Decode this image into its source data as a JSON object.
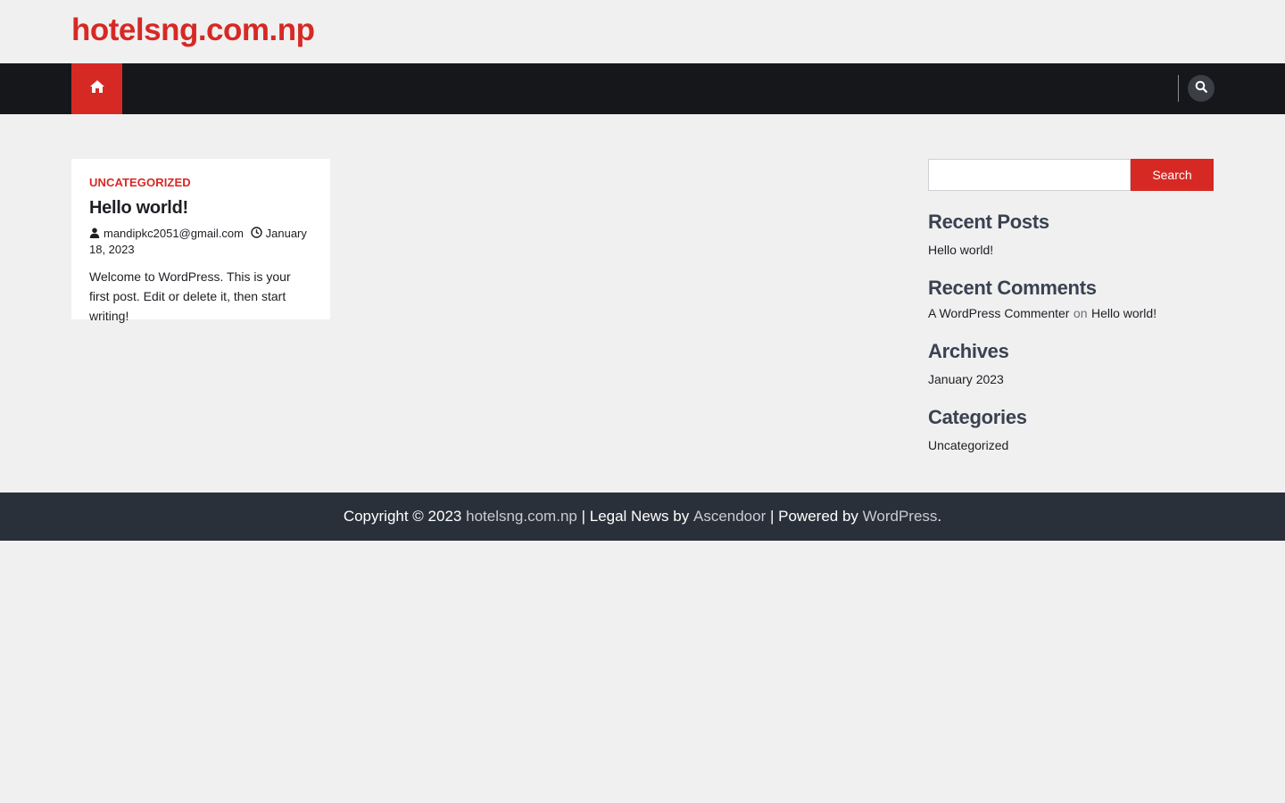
{
  "header": {
    "site_title": "hotelsng.com.np"
  },
  "nav": {
    "home_icon": "home-icon",
    "search_icon": "search-icon"
  },
  "post": {
    "category": "Uncategorized",
    "title": "Hello world!",
    "author": "mandipkc2051@gmail.com",
    "date": "January 18, 2023",
    "excerpt": "Welcome to WordPress. This is your first post. Edit or delete it, then start writing!"
  },
  "sidebar": {
    "search": {
      "placeholder": "",
      "button_label": "Search"
    },
    "recent_posts": {
      "title": "Recent Posts",
      "items": [
        "Hello world!"
      ]
    },
    "recent_comments": {
      "title": "Recent Comments",
      "items": [
        {
          "author": "A WordPress Commenter",
          "sep": "on",
          "post": "Hello world!"
        }
      ]
    },
    "archives": {
      "title": "Archives",
      "items": [
        "January 2023"
      ]
    },
    "categories": {
      "title": "Categories",
      "items": [
        "Uncategorized"
      ]
    }
  },
  "footer": {
    "copyright": "Copyright © 2023",
    "site_link": "hotelsng.com.np",
    "theme_text": "| Legal News by",
    "theme_link": "Ascendoor",
    "powered_text": "| Powered by",
    "powered_link": "WordPress",
    "end": "."
  },
  "colors": {
    "accent": "#d72924",
    "nav_bg": "#16171a",
    "footer_bg": "#2a303a",
    "page_bg": "#f0f0f1"
  }
}
